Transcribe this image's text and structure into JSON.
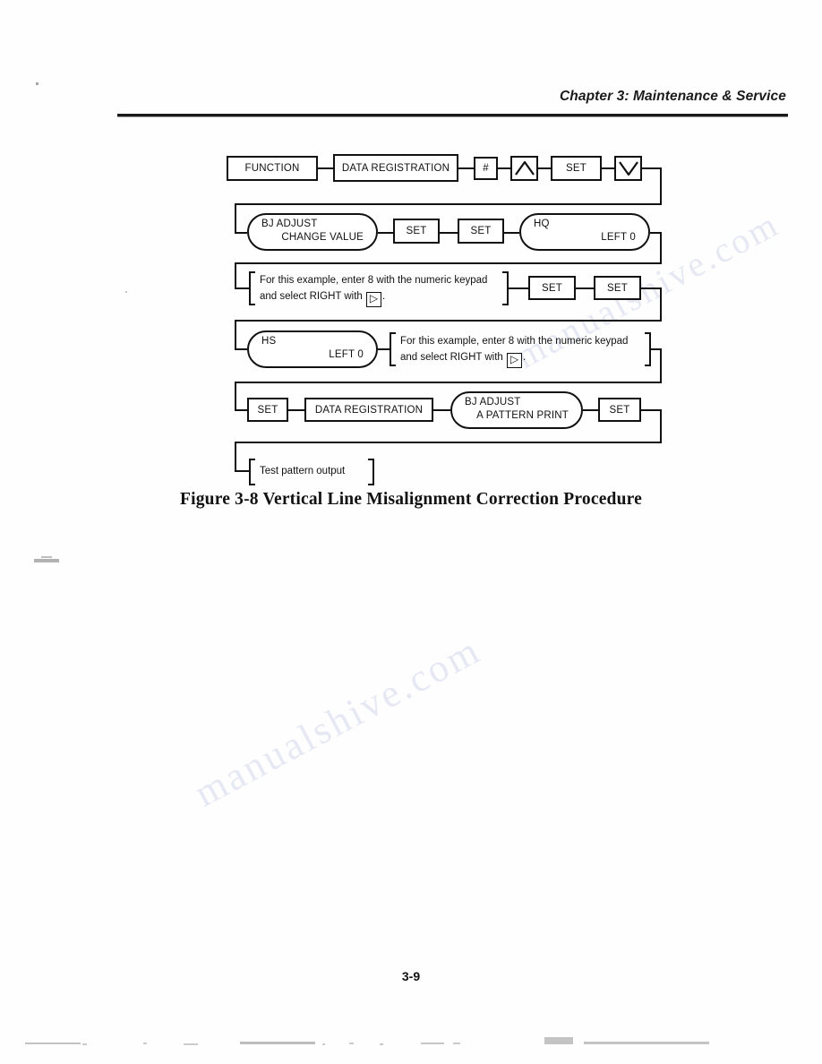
{
  "header": {
    "chapter_title": "Chapter 3: Maintenance & Service"
  },
  "figure": {
    "caption": "Figure 3-8 Vertical Line Misalignment Correction Procedure",
    "rows": [
      {
        "row": 1,
        "nodes": [
          {
            "kind": "rect",
            "label": "FUNCTION"
          },
          {
            "kind": "rect",
            "label": "DATA REGISTRATION"
          },
          {
            "kind": "rect",
            "label": "#"
          },
          {
            "kind": "rect-icon",
            "icon": "triangle-up-icon",
            "label": ""
          },
          {
            "kind": "rect",
            "label": "SET"
          },
          {
            "kind": "rect-icon",
            "icon": "triangle-down-icon",
            "label": ""
          }
        ]
      },
      {
        "row": 2,
        "nodes": [
          {
            "kind": "rounded",
            "line1": "BJ ADJUST",
            "line2": "CHANGE VALUE"
          },
          {
            "kind": "rect",
            "label": "SET"
          },
          {
            "kind": "rect",
            "label": "SET"
          },
          {
            "kind": "rounded",
            "line1": "HQ",
            "line2": "LEFT 0"
          }
        ]
      },
      {
        "row": 3,
        "nodes": [
          {
            "kind": "note",
            "line1": "For this example, enter 8 with the numeric keypad",
            "line2_pre": "and select RIGHT with ",
            "line2_key": "▷",
            "line2_post": "."
          },
          {
            "kind": "rect",
            "label": "SET"
          },
          {
            "kind": "rect",
            "label": "SET"
          }
        ]
      },
      {
        "row": 4,
        "nodes": [
          {
            "kind": "rounded",
            "line1": "HS",
            "line2": "LEFT 0"
          },
          {
            "kind": "note",
            "line1": "For this example, enter 8 with the numeric keypad",
            "line2_pre": "and select RIGHT with ",
            "line2_key": "▷",
            "line2_post": "."
          }
        ]
      },
      {
        "row": 5,
        "nodes": [
          {
            "kind": "rect",
            "label": "SET"
          },
          {
            "kind": "rect",
            "label": "DATA REGISTRATION"
          },
          {
            "kind": "rounded",
            "line1": "BJ ADJUST",
            "line2": "A PATTERN PRINT"
          },
          {
            "kind": "rect",
            "label": "SET"
          }
        ]
      },
      {
        "row": 6,
        "nodes": [
          {
            "kind": "note",
            "line1": "Test pattern output"
          }
        ]
      }
    ]
  },
  "footer": {
    "page_number": "3-9"
  },
  "watermark": {
    "text": "manualshive.com"
  },
  "colors": {
    "ink": "#111111",
    "paper": "#ffffff",
    "watermark": "#b9c0e2"
  }
}
